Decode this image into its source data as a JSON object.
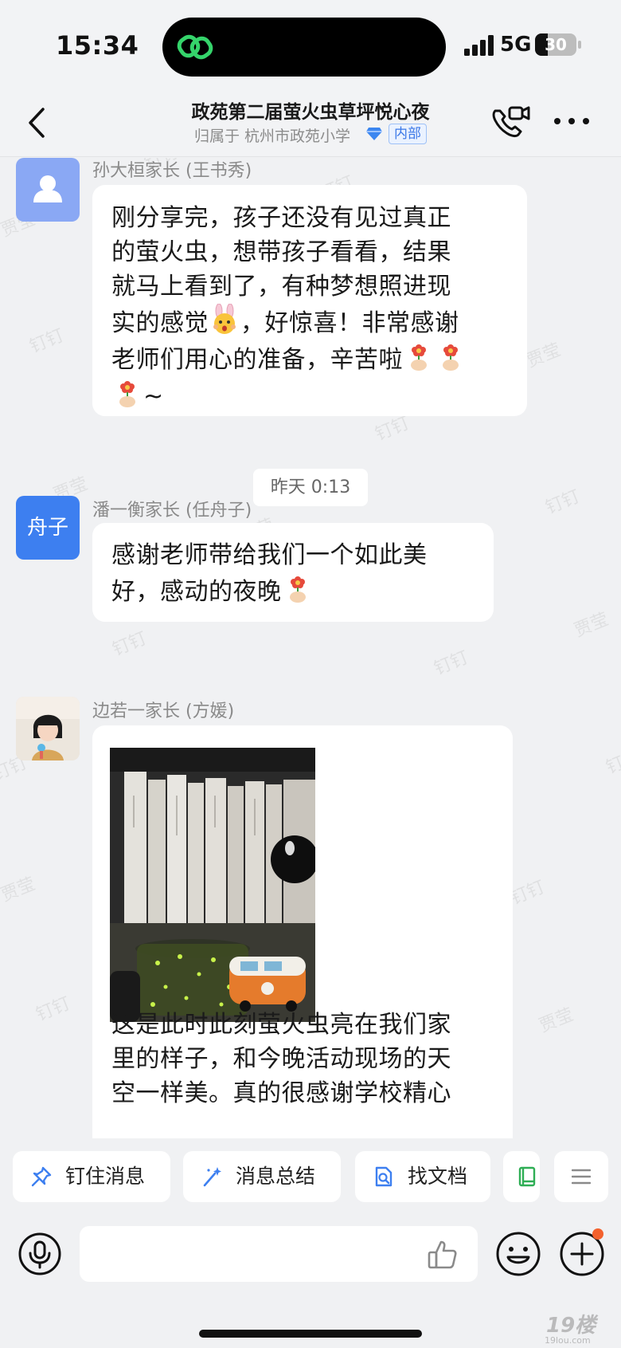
{
  "status_bar": {
    "time": "15:34",
    "network": "5G",
    "battery": "30",
    "battery_level": 0.3
  },
  "header": {
    "title": "政苑第二届萤火虫草坪悦心夜",
    "subtitle": "归属于 杭州市政苑小学",
    "tag": "内部"
  },
  "watermarks": [
    "钉钉",
    "贾莹"
  ],
  "messages": [
    {
      "sender": "孙大桓家长 (王书秀)",
      "lines": [
        "刚分享完，孩子还没有见过真正",
        "的萤火虫，想带孩子看看，结果",
        "就马上看到了，有种梦想照进现",
        "实的感觉",
        "，好惊喜！非常感谢",
        "老师们用心的准备，辛苦啦",
        "~"
      ]
    },
    {
      "time_divider": "昨天 0:13"
    },
    {
      "sender": "潘一衡家长 (任舟子)",
      "avatar_text": "舟子",
      "lines": [
        "感谢老师带给我们一个如此美",
        "好，感动的夜晚"
      ]
    },
    {
      "sender": "边若一家长 (方媛)",
      "lines": [
        "这是此时此刻萤火虫亮在我们家",
        "里的样子，和今晚活动现场的天",
        "空一样美。真的很感谢学校精心"
      ]
    }
  ],
  "quick_actions": [
    {
      "label": "钉住消息",
      "icon": "pin-icon"
    },
    {
      "label": "消息总结",
      "icon": "magic-wand-icon"
    },
    {
      "label": "找文档",
      "icon": "doc-search-icon"
    }
  ],
  "brand_watermark": {
    "main": "19楼",
    "sub": "19lou.com"
  },
  "colors": {
    "accent": "#3d7ff0",
    "background": "#f0f1f3",
    "notification_dot": "#f3612d"
  }
}
